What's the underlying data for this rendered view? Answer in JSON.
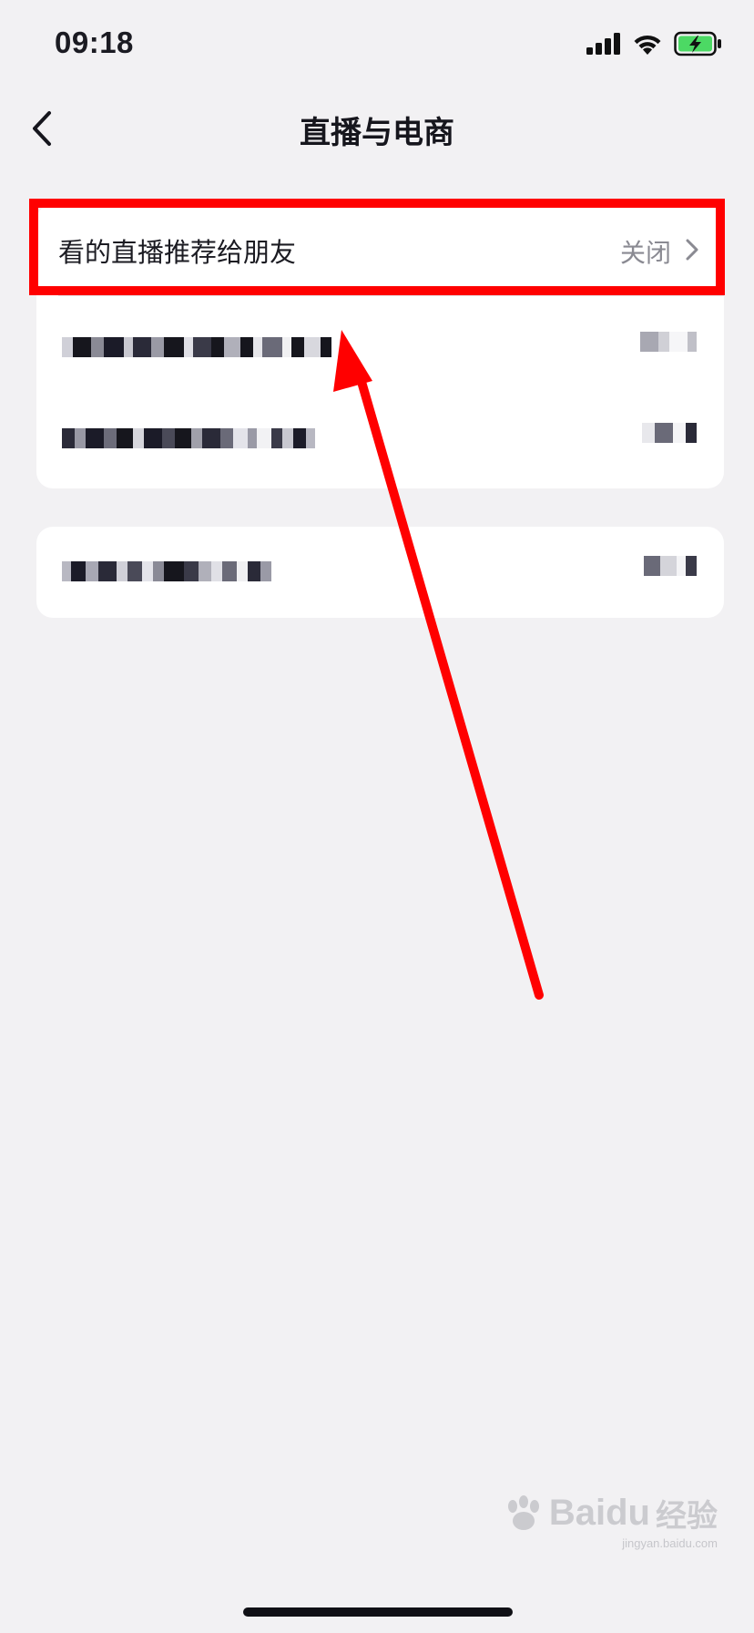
{
  "status_bar": {
    "time": "09:18",
    "icons": [
      "cellular-signal-icon",
      "wifi-icon",
      "battery-charging-icon"
    ],
    "battery_color": "#4cd964"
  },
  "nav": {
    "back_icon": "chevron-left-icon",
    "title": "直播与电商"
  },
  "settings": {
    "recommend_live": {
      "label": "看的直播推荐给朋友",
      "value": "关闭"
    }
  },
  "annotation": {
    "highlight_color": "#ff0000",
    "arrow_color": "#ff0000"
  },
  "watermark": {
    "brand": "Baidu",
    "sub": "经验",
    "url": "jingyan.baidu.com"
  },
  "colors": {
    "background": "#f2f1f3",
    "card": "#ffffff",
    "value_gray": "#8a8a92"
  }
}
